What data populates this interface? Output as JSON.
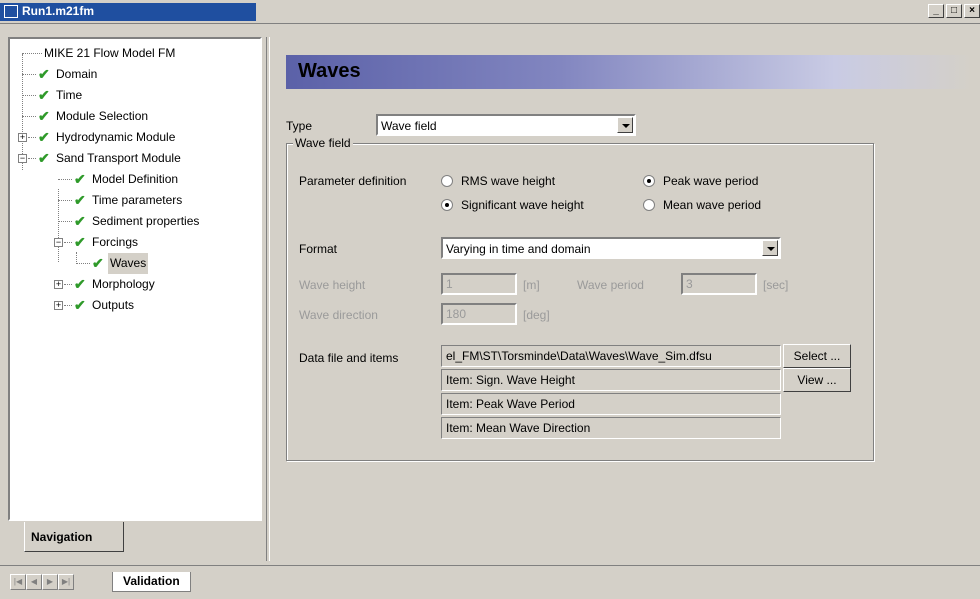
{
  "window": {
    "title": "Run1.m21fm",
    "minimize": "_",
    "maximize": "□",
    "close": "×"
  },
  "navigation": {
    "tab_label": "Navigation",
    "tree": [
      {
        "label": "MIKE 21 Flow Model FM"
      },
      {
        "label": "Domain"
      },
      {
        "label": "Time"
      },
      {
        "label": "Module Selection"
      },
      {
        "label": "Hydrodynamic Module"
      },
      {
        "label": "Sand Transport Module"
      },
      {
        "label": "Model Definition"
      },
      {
        "label": "Time parameters"
      },
      {
        "label": "Sediment properties"
      },
      {
        "label": "Forcings"
      },
      {
        "label": "Waves"
      },
      {
        "label": "Morphology"
      },
      {
        "label": "Outputs"
      }
    ]
  },
  "main": {
    "page_title": "Waves",
    "type": {
      "label": "Type",
      "value": "Wave field"
    },
    "group": {
      "legend": "Wave field",
      "param_def_label": "Parameter definition",
      "radios": {
        "rms": "RMS wave height",
        "significant": "Significant wave height",
        "peak": "Peak wave period",
        "mean": "Mean wave period"
      },
      "format": {
        "label": "Format",
        "value": "Varying in time and domain"
      },
      "wave_height": {
        "label": "Wave height",
        "value": "1",
        "unit": "[m]"
      },
      "wave_period": {
        "label": "Wave period",
        "value": "3",
        "unit": "[sec]"
      },
      "wave_direction": {
        "label": "Wave direction",
        "value": "180",
        "unit": "[deg]"
      },
      "data_file": {
        "label": "Data file and items",
        "path": "el_FM\\ST\\Torsminde\\Data\\Waves\\Wave_Sim.dfsu",
        "select_label": "Select ...",
        "view_label": "View ...",
        "items": [
          "Item:   Sign. Wave Height",
          "Item:   Peak Wave Period",
          "Item:   Mean Wave Direction"
        ]
      }
    }
  },
  "bottom": {
    "tab_label": "Validation"
  },
  "colors": {
    "titlebar": "#1f4fa0",
    "check": "#2f9a2a",
    "header_gradient_start": "#5b61a8"
  },
  "icons": [
    "app-icon",
    "check-icon",
    "expand-icon",
    "collapse-icon",
    "nav-first-icon",
    "nav-prev-icon",
    "nav-next-icon",
    "nav-last-icon"
  ]
}
